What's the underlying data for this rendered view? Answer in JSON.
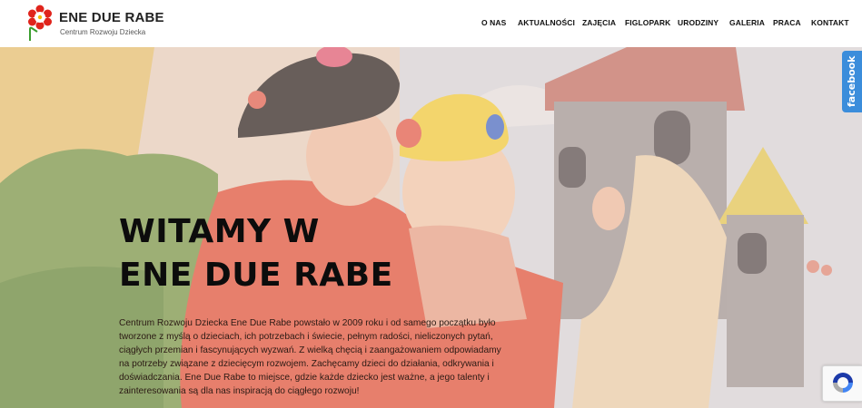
{
  "brand": {
    "title": "ENE DUE RABE",
    "subtitle": "Centrum Rozwoju Dziecka",
    "logo_icon": "flower-logo-icon"
  },
  "nav": {
    "items": [
      {
        "label": "O NAS"
      },
      {
        "label": "AKTUALNOŚCI"
      },
      {
        "label": "ZAJĘCIA"
      },
      {
        "label": "FIGLOPARK"
      },
      {
        "label": "URODZINY"
      },
      {
        "label": "GALERIA"
      },
      {
        "label": "PRACA"
      },
      {
        "label": "KONTAKT"
      }
    ]
  },
  "hero": {
    "title_line1": "WITAMY W",
    "title_line2": "ENE DUE RABE",
    "body": "Centrum Rozwoju Dziecka Ene Due Rabe powstało w 2009 roku i od samego początku było tworzone z myślą o dzieciach, ich potrzebach i świecie, pełnym radości, nieliczonych pytań, ciągłych przemian i fascynujących wyzwań. Z wielką chęcią i zaangażowaniem odpowiadamy na potrzeby związane z dziecięcym rozwojem. Zachęcamy dzieci do działania, odkrywania i doświadczania. Ene Due Rabe to miejsce, gdzie każde dziecko jest ważne, a jego talenty i zainteresowania są dla nas inspiracją do ciągłego rozwoju!"
  },
  "social": {
    "facebook_label": "facebook"
  },
  "colors": {
    "header_bg": "#ffffff",
    "facebook": "#3b8ddb",
    "hero_overlay": "#f4d6cc"
  }
}
